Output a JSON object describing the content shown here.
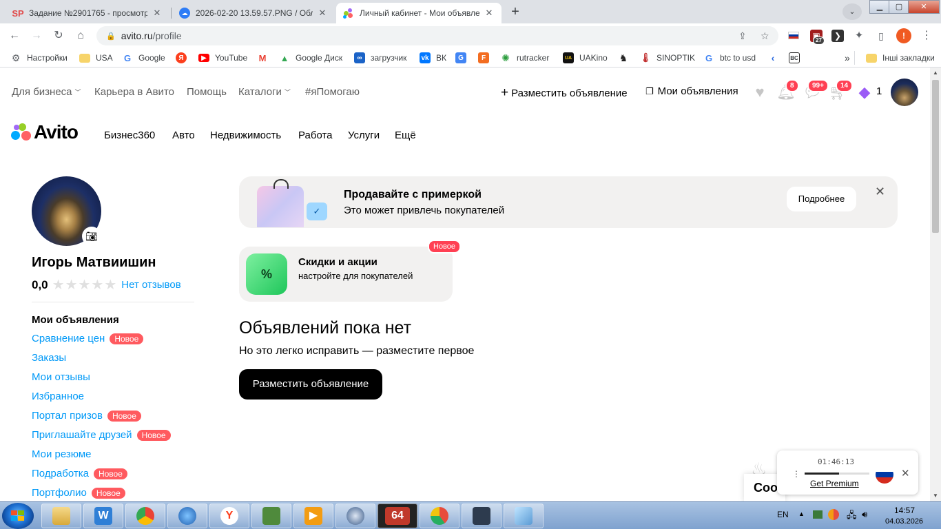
{
  "browser": {
    "tabs": [
      {
        "title": "Задание №2901765 - просмотр",
        "favicon_text": "SP",
        "favicon_color": "#e04b4b"
      },
      {
        "title": "2026-02-20 13.59.57.PNG / Обла",
        "favicon_text": "",
        "favicon_color": "#2e7cf6"
      },
      {
        "title": "Личный кабинет - Мои объявле",
        "favicon_text": "",
        "favicon_color": "#00aaff"
      }
    ],
    "new_tab_label": "+",
    "url_host": "avito.ru",
    "url_path": "/profile",
    "profile_initial": "!",
    "ext_badge": "27",
    "bookmarks": [
      {
        "label": "Настройки",
        "icon": "gear-icon"
      },
      {
        "label": "USA",
        "icon": "folder-icon"
      },
      {
        "label": "Google",
        "icon": "google-icon"
      },
      {
        "label": "",
        "icon": "yandex-icon"
      },
      {
        "label": "YouTube",
        "icon": "youtube-icon"
      },
      {
        "label": "",
        "icon": "gmail-icon"
      },
      {
        "label": "Google Диск",
        "icon": "drive-icon"
      },
      {
        "label": "загрузчик",
        "icon": "loop-icon"
      },
      {
        "label": "ВК",
        "icon": "vk-icon"
      },
      {
        "label": "",
        "icon": "translate-icon"
      },
      {
        "label": "",
        "icon": "f-icon"
      },
      {
        "label": "rutracker",
        "icon": "rutracker-icon"
      },
      {
        "label": "UAKino",
        "icon": "uakino-icon"
      },
      {
        "label": "",
        "icon": "chess-icon"
      },
      {
        "label": "SINOPTIK",
        "icon": "thermometer-icon"
      },
      {
        "label": "btc to usd",
        "icon": "google-icon"
      },
      {
        "label": "",
        "icon": "arrow-icon"
      },
      {
        "label": "",
        "icon": "bc-icon"
      }
    ],
    "bookmarks_more": "»",
    "other_bookmarks": "Інші закладки"
  },
  "site": {
    "top_links": [
      {
        "label": "Для бизнеса",
        "dropdown": true
      },
      {
        "label": "Карьера в Авито",
        "dropdown": false
      },
      {
        "label": "Помощь",
        "dropdown": false
      },
      {
        "label": "Каталоги",
        "dropdown": true
      },
      {
        "label": "#яПомогаю",
        "dropdown": false
      }
    ],
    "post_ad_label": "Разместить объявление",
    "my_ads_label": "Мои объявления",
    "badges": {
      "notifications": "8",
      "messages": "99+",
      "cart": "14",
      "bonus": "1"
    },
    "logo_text": "Avito",
    "categories": [
      "Бизнес360",
      "Авто",
      "Недвижимость",
      "Работа",
      "Услуги",
      "Ещё"
    ]
  },
  "profile": {
    "name": "Игорь Матвиишин",
    "rating": "0,0",
    "stars": "★★★★★",
    "reviews_link": "Нет отзывов",
    "menu_title": "Мои объявления",
    "new_tag": "Новое",
    "menu": [
      {
        "label": "Сравнение цен",
        "new": true
      },
      {
        "label": "Заказы",
        "new": false
      },
      {
        "label": "Мои отзывы",
        "new": false
      },
      {
        "label": "Избранное",
        "new": false
      },
      {
        "label": "Портал призов",
        "new": true
      },
      {
        "label": "Приглашайте друзей",
        "new": true
      },
      {
        "label": "Мои резюме",
        "new": false
      },
      {
        "label": "Подработка",
        "new": true
      },
      {
        "label": "Портфолио",
        "new": true
      }
    ]
  },
  "main": {
    "banner1": {
      "title": "Продавайте с примеркой",
      "subtitle": "Это может привлечь покупателей",
      "button": "Подробнее"
    },
    "banner2": {
      "badge": "Новое",
      "title": "Скидки и акции",
      "subtitle": "настройте для покупателей",
      "icon_text": "%"
    },
    "empty_title": "Объявлений пока нет",
    "empty_text": "Но это легко исправить — разместите первое",
    "post_button": "Разместить объявление"
  },
  "cookie": {
    "text": "Coo"
  },
  "vpn": {
    "time": "01:46:13",
    "premium": "Get Premium",
    "progress": 0.53
  },
  "taskbar": {
    "lang": "EN",
    "time": "14:57",
    "date": "04.03.2026",
    "badge_64": "64"
  },
  "colors": {
    "avito_blue": "#0099f7",
    "badge_red": "#ff4053",
    "new_red": "#ff5a5f"
  }
}
